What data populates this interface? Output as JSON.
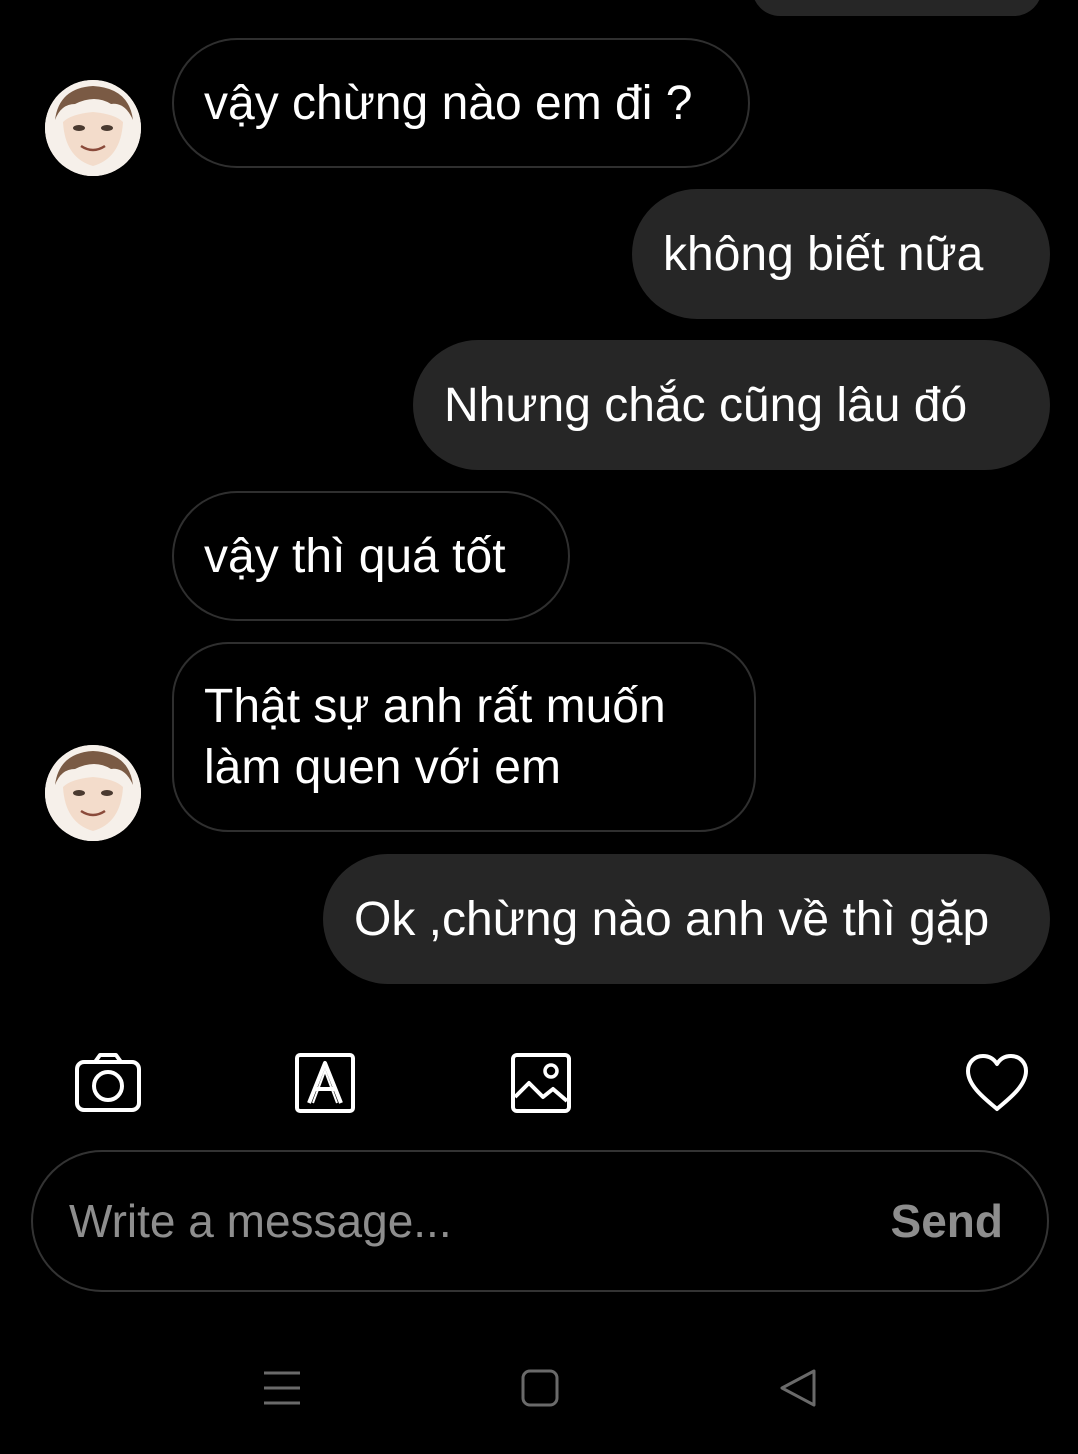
{
  "messages": [
    {
      "direction": "incoming",
      "text": "vậy chừng nào em đi ?"
    },
    {
      "direction": "outgoing",
      "text": "không biết nữa"
    },
    {
      "direction": "outgoing",
      "text": "Nhưng chắc cũng lâu đó"
    },
    {
      "direction": "incoming",
      "text": "vậy thì quá tốt"
    },
    {
      "direction": "incoming",
      "text": "Thật sự anh rất muốn làm quen với em"
    },
    {
      "direction": "outgoing",
      "text": "Ok ,chừng nào anh về thì gặp"
    }
  ],
  "contact": {
    "avatar_icon": "user-avatar"
  },
  "toolbar": {
    "icons": [
      "camera-icon",
      "sticker-icon",
      "gallery-icon",
      "heart-icon"
    ]
  },
  "composer": {
    "placeholder": "Write a message...",
    "value": "",
    "send_label": "Send"
  },
  "navbar": {
    "icons": [
      "menu-icon",
      "home-icon",
      "back-icon"
    ]
  },
  "colors": {
    "background": "#000000",
    "outgoing_bubble": "#262626",
    "incoming_border": "#2f2f2f",
    "text": "#ffffff",
    "muted": "#8e8e8e"
  }
}
